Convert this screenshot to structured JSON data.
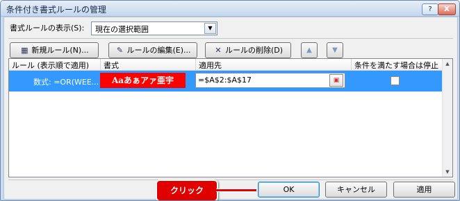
{
  "window": {
    "title": "条件付き書式ルールの管理",
    "help_label": "?",
    "close_label": "X"
  },
  "show_rules": {
    "label": "書式ルールの表示(S):",
    "selected": "現在の選択範囲"
  },
  "toolbar": {
    "new_label": "新規ルール(N)...",
    "edit_label": "ルールの編集(E)...",
    "delete_label": "ルールの削除(D)",
    "up_icon": "up-arrow-icon",
    "down_icon": "down-arrow-icon"
  },
  "table": {
    "columns": [
      "ルール (表示順で適用)",
      "書式",
      "適用先",
      "条件を満たす場合は停止"
    ],
    "rows": [
      {
        "rule": "数式: =OR(WEE...",
        "format_preview": "Aaあぁアァ亜宇",
        "applies_to": "=$A$2:$A$17",
        "stop_if_true": false
      }
    ]
  },
  "footer": {
    "ok_label": "OK",
    "cancel_label": "キャンセル",
    "apply_label": "適用"
  },
  "annotation": {
    "label": "クリック"
  },
  "colors": {
    "selection": "#3399ff",
    "format_fill": "#ff0000",
    "annotation": "#e00000"
  }
}
